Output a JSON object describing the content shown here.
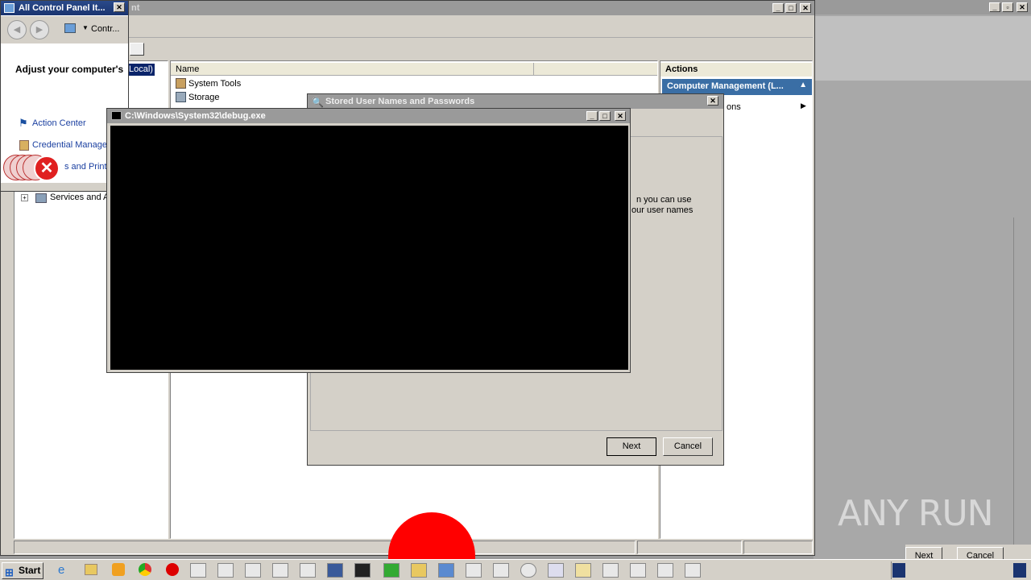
{
  "control_panel": {
    "title": "All Control Panel It...",
    "address": "Contr...",
    "heading": "Adjust your computer's",
    "items": [
      "Action Center",
      "Credential Manager",
      "s and Printer"
    ]
  },
  "computer_mgmt": {
    "title_fragment": "nt",
    "tree_selected": "Local)",
    "tree_item": "Services and A",
    "list_header": "Name",
    "list_items": [
      "System Tools",
      "Storage"
    ],
    "actions_header": "Actions",
    "actions_sub": "Computer Management (L...",
    "actions_more": "ons"
  },
  "stored_users": {
    "title": "Stored User Names and Passwords",
    "text_line1": "n you can use",
    "text_line2": "our user names",
    "next": "Next",
    "cancel": "Cancel"
  },
  "debug_console": {
    "title": "C:\\Windows\\System32\\debug.exe"
  },
  "right_wizard": {
    "next": "Next",
    "cancel": "Cancel"
  },
  "taskbar": {
    "start": "Start"
  },
  "watermark": "ANY RUN",
  "colors": {
    "title_active": "#1a3470",
    "console_bg": "#000000",
    "error_red": "#e02020",
    "blob_red": "#ff0000"
  }
}
